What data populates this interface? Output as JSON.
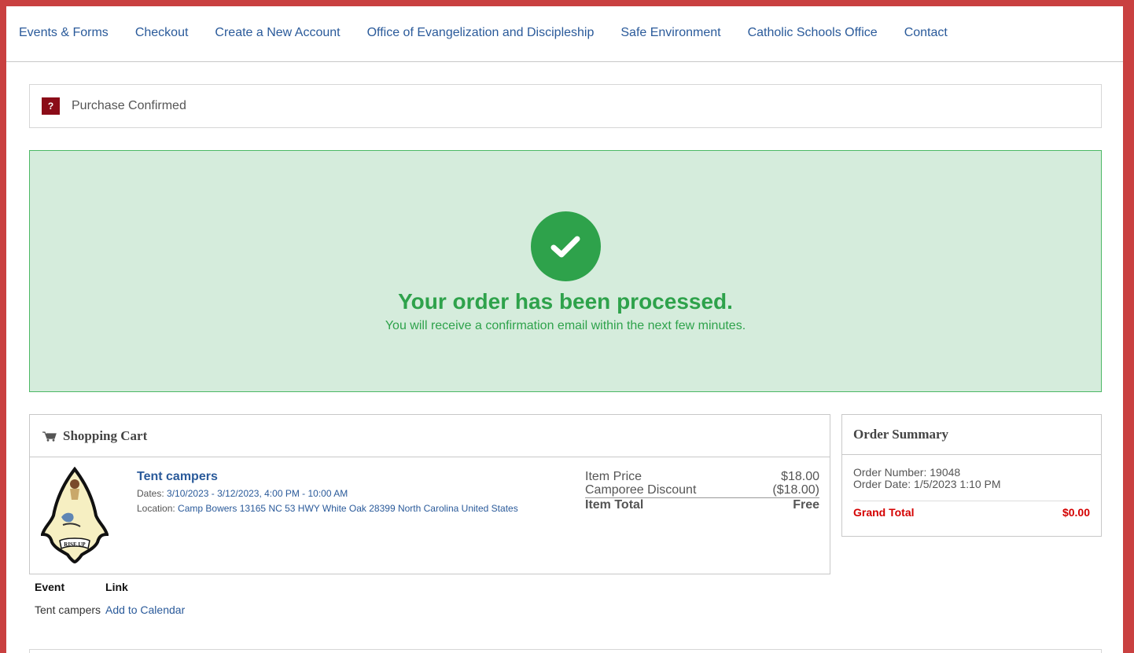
{
  "nav": {
    "items": [
      {
        "label": "Events & Forms"
      },
      {
        "label": "Checkout"
      },
      {
        "label": "Create a New Account"
      },
      {
        "label": "Office of Evangelization and Discipleship"
      },
      {
        "label": "Safe Environment"
      },
      {
        "label": "Catholic Schools Office"
      },
      {
        "label": "Contact"
      }
    ]
  },
  "breadcrumb": {
    "icon_text": "?",
    "label": "Purchase Confirmed"
  },
  "success": {
    "icon": "check-icon",
    "title": "Your order has been processed.",
    "message": "You will receive a confirmation email within the next few minutes."
  },
  "cart": {
    "title": "Shopping Cart",
    "icon": "cart-icon",
    "item": {
      "title": "Tent campers",
      "dates_label": "Dates:",
      "dates_value": "3/10/2023 - 3/12/2023, 4:00 PM - 10:00 AM",
      "location_label": "Location:",
      "location_value": "Camp Bowers 13165 NC 53 HWY White Oak 28399 North Carolina United States",
      "image_caption": "RISE UP",
      "price_label": "Item Price",
      "price_value": "$18.00",
      "discount_label": "Camporee Discount",
      "discount_value": "($18.00)",
      "total_label": "Item Total",
      "total_value": "Free"
    }
  },
  "summary": {
    "title": "Order Summary",
    "order_number": "Order Number: 19048",
    "order_date": "Order Date: 1/5/2023 1:10 PM",
    "grand_total_label": "Grand Total",
    "grand_total_value": "$0.00"
  },
  "event_table": {
    "headers": [
      "Event",
      "Link"
    ],
    "rows": [
      {
        "event": "Tent campers",
        "link": "Add to Calendar"
      }
    ]
  },
  "colors": {
    "frame": "#c94040",
    "link": "#2a5a9a",
    "success_bg": "#d5ecdc",
    "success_green": "#2ea24b",
    "badge": "#8b0c18",
    "grand_total": "#d40000"
  }
}
